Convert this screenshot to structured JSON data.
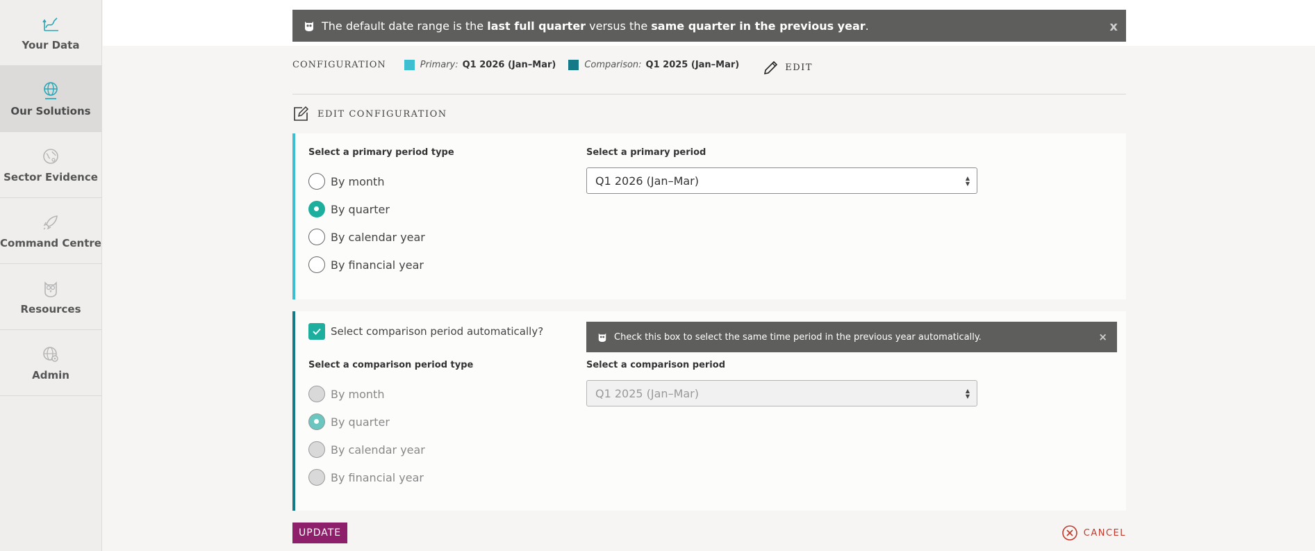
{
  "sidebar": {
    "items": [
      {
        "label": "Your Data",
        "icon": "chart-line-icon"
      },
      {
        "label": "Our Solutions",
        "icon": "globe-icon"
      },
      {
        "label": "Sector Evidence",
        "icon": "sector-globe-icon"
      },
      {
        "label": "Command Centre",
        "icon": "rocket-icon"
      },
      {
        "label": "Resources",
        "icon": "owl-icon"
      },
      {
        "label": "Admin",
        "icon": "gear-globe-icon"
      }
    ]
  },
  "banner": {
    "text_a": "The default date range is the ",
    "bold_a": "last full quarter",
    "text_b": " versus the ",
    "bold_b": "same quarter in the previous year",
    "text_c": ".",
    "close": "x"
  },
  "configuration": {
    "title": "CONFIGURATION",
    "primary_label": "Primary:",
    "primary_value": "Q1 2026 (Jan–Mar)",
    "primary_color": "#3bbfd1",
    "comparison_label": "Comparison:",
    "comparison_value": "Q1 2025 (Jan–Mar)",
    "comparison_color": "#157a87",
    "edit_label": "EDIT"
  },
  "edit_config": {
    "title": "EDIT CONFIGURATION"
  },
  "primary_panel": {
    "type_label": "Select a primary period type",
    "options": [
      "By month",
      "By quarter",
      "By calendar year",
      "By financial year"
    ],
    "selected_index": 1,
    "period_label": "Select a primary period",
    "period_value": "Q1 2026 (Jan–Mar)"
  },
  "comparison_panel": {
    "auto_label": "Select comparison period automatically?",
    "auto_checked": true,
    "hint": "Check this box to select the same time period in the previous year automatically.",
    "hint_close": "×",
    "type_label": "Select a comparison period type",
    "options": [
      "By month",
      "By quarter",
      "By calendar year",
      "By financial year"
    ],
    "selected_index": 1,
    "period_label": "Select a comparison period",
    "period_value": "Q1 2025 (Jan–Mar)"
  },
  "actions": {
    "update": "UPDATE",
    "cancel": "CANCEL"
  }
}
